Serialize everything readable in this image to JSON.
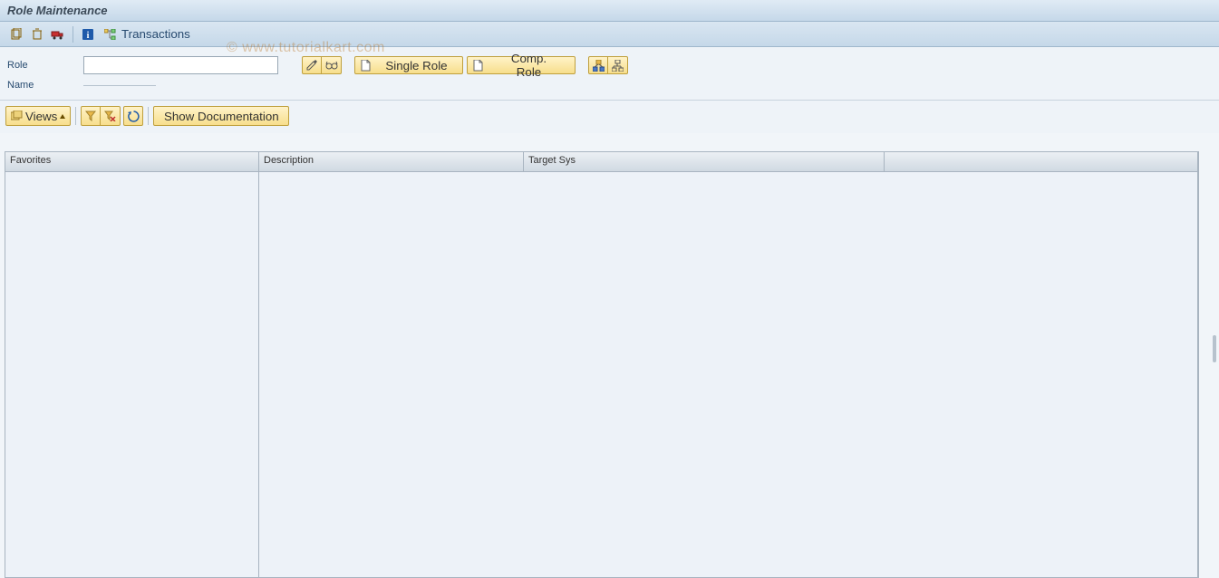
{
  "title": "Role Maintenance",
  "watermark": "© www.tutorialkart.com",
  "toolbar": {
    "copy_icon": "copy",
    "delete_icon": "trash",
    "transport_icon": "transport",
    "info_icon": "info",
    "transactions_icon": "tree",
    "transactions_label": "Transactions"
  },
  "form": {
    "role_label": "Role",
    "role_value": "",
    "name_label": "Name",
    "edit_icon": "pencil",
    "display_icon": "glasses",
    "create_icon": "document",
    "single_role_label": "Single Role",
    "comp_role_icon": "document",
    "comp_role_label": "Comp. Role",
    "where_used_icon": "where-used",
    "hierarchy_icon": "hierarchy"
  },
  "subtoolbar": {
    "views_icon": "copy-folder",
    "views_label": "Views",
    "filter_icon": "filter",
    "filter_del_icon": "filter-delete",
    "refresh_icon": "refresh",
    "show_doc_label": "Show Documentation"
  },
  "grid": {
    "columns": {
      "favorites": "Favorites",
      "description": "Description",
      "target_sys": "Target Sys"
    }
  }
}
